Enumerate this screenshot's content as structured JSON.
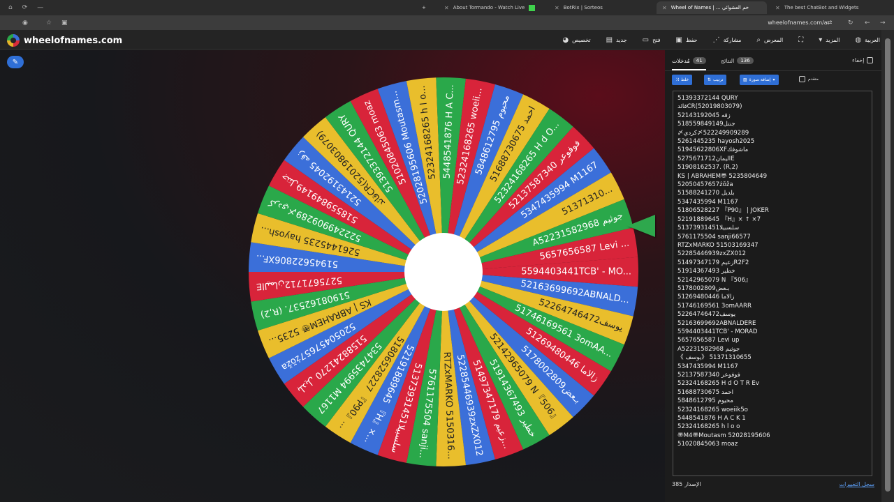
{
  "browser": {
    "window_controls": [
      "⌂",
      "⟳",
      "—"
    ],
    "tabs": [
      {
        "title": "About Tormando - Watch Live"
      },
      {
        "title": "BotRix | Sorteos"
      },
      {
        "title": "Wheel of Names | ... خم العشوائي"
      },
      {
        "title": "The best ChatBot and Widgets"
      }
    ],
    "url": "wheelofnames.com/ar"
  },
  "header": {
    "site_name": "wheelofnames.com",
    "menu": [
      {
        "label": "تخصيص",
        "icon": "palette-icon"
      },
      {
        "label": "جديد",
        "icon": "new-file-icon"
      },
      {
        "label": "فتح",
        "icon": "folder-icon"
      },
      {
        "label": "حفظ",
        "icon": "save-icon"
      },
      {
        "label": "مشاركة",
        "icon": "share-icon"
      },
      {
        "label": "المعرض",
        "icon": "search-icon"
      },
      {
        "label": "",
        "icon": "fullscreen-icon"
      },
      {
        "label": "المزيد",
        "icon": "more-icon"
      },
      {
        "label": "العربية",
        "icon": "globe-icon"
      }
    ]
  },
  "panel": {
    "hide_label": "إخفاء",
    "results_label": "النتائج",
    "results_count": "136",
    "entries_label": "مُدخلات",
    "entries_count": "41",
    "shuffle_label": "خلط",
    "sort_label": "ترتيب",
    "add_image_label": "إضافة صورة",
    "advanced_label": "متقدم",
    "version_label": "الإصدار 385",
    "changelog_label": "سجل التغييرات"
  },
  "entries": [
    "51393372144 QURY",
    "قائدCR(52019803079)",
    "52143192045 زقه",
    "518559849149جنتل",
    "〆كردي〆522249909289",
    "5261445235 hayosh2025",
    "51945622806XFماشوفك",
    "5275671712اليمانE",
    "51908162537. (R,2)",
    "KS | ABRAHEM〠 5235804649",
    "52050457657żŏža",
    "51588241270 بلديل",
    "5347435994 M1167",
    "51806528227 『P90』 | JOKER",
    "52191889645 『H』× ↑ ×7",
    "51373931451سلسبيلا",
    "5761175504 sanji66577",
    "RTZxMARKO 51503169347",
    "52285446939zxZX012",
    "51497347179 زعيمR2F2",
    "51914367493 خطير",
    "52142965079 N 『506』",
    "5178002809بـعض",
    "51269480446 زالاما",
    "51746169561 3omAARR",
    "52264746472يوسف",
    "52163699692ABNALDERE",
    "5594403441TCB' - MORAD",
    "5657656587 Levi up",
    "A52231582968 جوثيم",
    "《 يوسف》 51371310655",
    "5347435994 M1167",
    "52137587340 فوفوعر",
    "52324168265 H d O T R Ev",
    "51688730675 احمد",
    "5848612795 محيوم",
    "52324168265 woeiik5o",
    "5448541876 H A C K 1",
    "52324168265 h l o o",
    "〠M4〠Moutasm 52028195606",
    "51020845063 moaz"
  ],
  "wheel": {
    "colors": [
      "#d8243a",
      "#3b6fd9",
      "#e9be2c",
      "#2aa84a"
    ],
    "segments": [
      "5594403441TCB' - MO...",
      "52163699692ABNALD...",
      "52264746472يوسف",
      "51746169561 3omAA...",
      "51269480446 زالاما",
      "5178002809بـعض",
      "52142965079 N『506』",
      "51914367493 خطير",
      "51497347179 زعيم...",
      "52285446939zxZX012",
      "RTZxMARKO 5150316...",
      "5761175504 sanji...",
      "51373931451سلسبيلا",
      "52191889645 『H』×...",
      "51806528227 『P90』...",
      "5347435994 M1167",
      "51588241270 بلديل",
      "52050457657żŏža",
      "KS | ABRAHEM〠 5235...",
      "51908162537. (R,2)",
      "5275671712اليمانE",
      "51945622806XF...",
      "5261445235 hayosh...",
      "522249909289〆كردي",
      "518559849149جنتل",
      "52143192045 زقه",
      "قائدCR(52019803079)",
      "51393372144 QURY",
      "51020845063 moaz",
      "52028195606 Moutasm...",
      "52324168265 h l o...",
      "5448541876 H A C...",
      "52324168265 woeii...",
      "5848612795 محيوم",
      "51688730675 احمد",
      "52324168265 H d O...",
      "52137587340 فوفوعر",
      "5347435994 M1167",
      "51371310...",
      "A52231582968 جوثيم",
      "5657656587 Levi ..."
    ]
  }
}
